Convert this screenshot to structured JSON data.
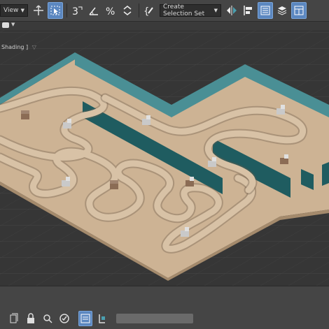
{
  "toolbar": {
    "view_dropdown": "View",
    "selection_set_dropdown": "Create Selection Set",
    "icons": [
      "select-move-icon",
      "select-object-icon",
      "snap-3d-icon",
      "angle-snap-icon",
      "percent-snap-icon",
      "spinner-snap-icon",
      "edit-named-selection-icon",
      "mirror-icon",
      "align-icon",
      "scene-explorer-icon",
      "layer-explorer-icon",
      "toggle-ribbon-icon"
    ]
  },
  "viewport": {
    "label": "Shading ]",
    "colors": {
      "floor": "#cdb394",
      "track": "#d8c2a6",
      "wall_top": "#4a8f95",
      "wall_side": "#1f5c60",
      "grid_bg": "#363636"
    }
  },
  "statusbar": {
    "icons": [
      "add-time-tag-icon",
      "lock-selection-icon",
      "isolate-selection-icon",
      "adaptive-degradation-icon",
      "selection-lock-icon",
      "absolute-mode-icon",
      "grid-icon"
    ]
  }
}
